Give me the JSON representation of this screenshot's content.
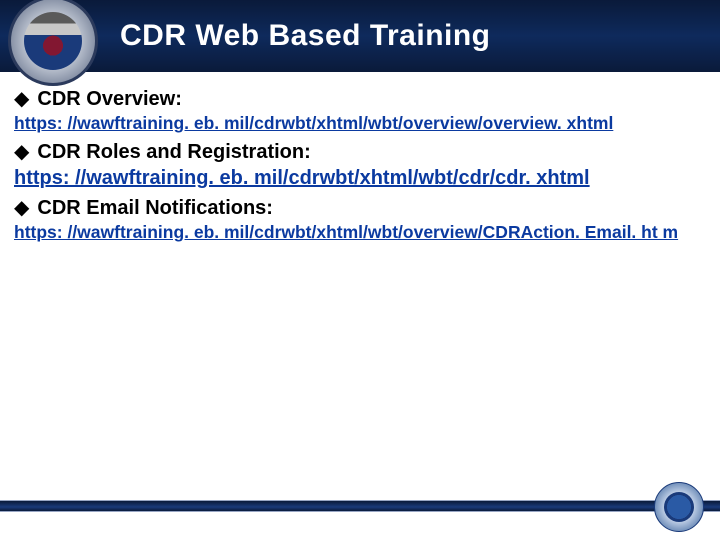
{
  "header": {
    "title": "CDR Web Based Training"
  },
  "items": [
    {
      "label": "CDR Overview:",
      "link": "https: //wawftraining. eb. mil/cdrwbt/xhtml/wbt/overview/overview. xhtml",
      "linkLarge": false
    },
    {
      "label": "CDR Roles and Registration:",
      "link": "https: //wawftraining. eb. mil/cdrwbt/xhtml/wbt/cdr/cdr. xhtml",
      "linkLarge": true
    },
    {
      "label": "CDR Email Notifications:",
      "link": "https: //wawftraining. eb. mil/cdrwbt/xhtml/wbt/overview/CDRAction. Email. ht m",
      "linkLarge": false
    }
  ]
}
